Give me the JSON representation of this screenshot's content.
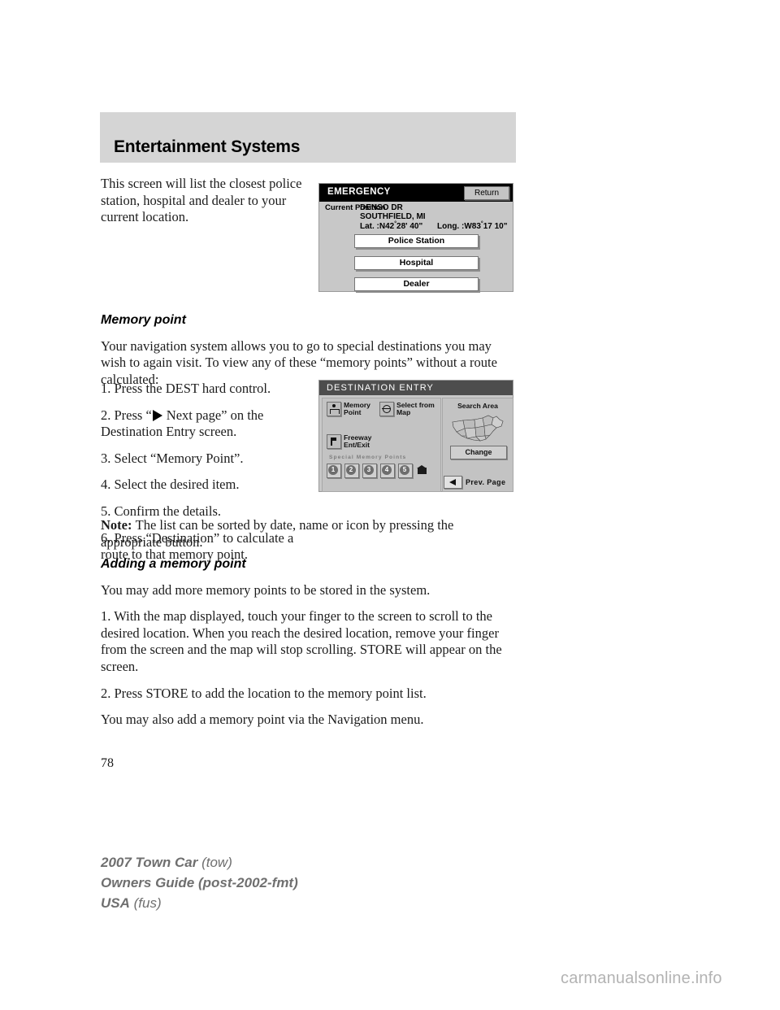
{
  "chapter": {
    "title": "Entertainment Systems"
  },
  "intro": {
    "text": "This screen will list the closest police station, hospital and dealer to your current location."
  },
  "emergency_screen": {
    "title": "EMERGENCY",
    "return_label": "Return",
    "position_label": "Current\nPosition",
    "address_line1": "DENSO DR",
    "address_line2": "SOUTHFIELD, MI",
    "lat_prefix": "Lat. :N42",
    "lat_suffix": "28' 40\"",
    "long_prefix": "Long. :W83",
    "long_suffix": "17 10\"",
    "degree_symbol": "°",
    "buttons": [
      "Police Station",
      "Hospital",
      "Dealer"
    ]
  },
  "memory_point": {
    "heading": "Memory point",
    "intro": "Your navigation system allows you to go to special destinations you may wish to again visit. To view any of these “memory points” without a route calculated:",
    "step1": "1. Press the DEST hard control.",
    "step2_part1": "2. Press “",
    "step2_part2": "Next page” on the Destination Entry screen.",
    "step3": "3. Select “Memory Point”.",
    "step4": "4. Select the desired item.",
    "step5": "5. Confirm the details.",
    "step6": "6. Press “Destination” to calculate a route to that memory point.",
    "note_label": "Note:",
    "note_text": "The list can be sorted by date, name or icon by pressing the appropriate button."
  },
  "destination_screen": {
    "title": "DESTINATION ENTRY",
    "menu_items": [
      {
        "label": "Memory\nPoint",
        "icon": "memory-point-icon"
      },
      {
        "label": "Select from\nMap",
        "icon": "globe-icon"
      },
      {
        "label": "Freeway\nEnt/Exit",
        "icon": "freeway-flag-icon"
      }
    ],
    "special_memory_points_label": "Special Memory Points",
    "special_memory_points": [
      "1",
      "2",
      "3",
      "4",
      "5"
    ],
    "home_icon_name": "home-icon",
    "search_area_label": "Search Area",
    "change_label": "Change",
    "prev_page_label": "Prev. Page"
  },
  "adding_memory_point": {
    "heading": "Adding a memory point",
    "intro": "You may add more memory points to be stored in the system.",
    "step1": "1. With the map displayed, touch your finger to the screen to scroll to the desired location. When you reach the desired location, remove your finger from the screen and the map will stop scrolling. STORE will appear on the screen.",
    "step2": "2. Press STORE to add the location to the memory point list.",
    "closing": "You may also add a memory point via the Navigation menu."
  },
  "page_number": "78",
  "footer": {
    "line1_strong": "2007 Town Car",
    "line1_light": "(tow)",
    "line2_strong": "Owners Guide (post-2002-fmt)",
    "line3_strong": "USA",
    "line3_light": "(fus)"
  },
  "watermark": "carmanualsonline.info"
}
